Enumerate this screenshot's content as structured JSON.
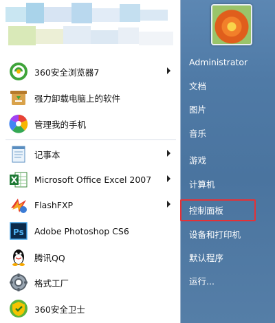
{
  "user": {
    "name": "Administrator"
  },
  "programs": [
    {
      "label": "360安全浏览器7",
      "icon": "360-browser-icon",
      "submenu": true
    },
    {
      "label": "强力卸载电脑上的软件",
      "icon": "uninstall-icon",
      "submenu": false
    },
    {
      "label": "管理我的手机",
      "icon": "phone-manager-icon",
      "submenu": false
    },
    {
      "label": "记事本",
      "icon": "notepad-icon",
      "submenu": true
    },
    {
      "label": "Microsoft Office Excel 2007",
      "icon": "excel-icon",
      "submenu": true
    },
    {
      "label": "FlashFXP",
      "icon": "flashfxp-icon",
      "submenu": true
    },
    {
      "label": "Adobe Photoshop CS6",
      "icon": "photoshop-icon",
      "submenu": false
    },
    {
      "label": "腾讯QQ",
      "icon": "qq-icon",
      "submenu": false
    },
    {
      "label": "格式工厂",
      "icon": "format-factory-icon",
      "submenu": false
    },
    {
      "label": "360安全卫士",
      "icon": "360-safe-icon",
      "submenu": false
    }
  ],
  "right_menu": [
    {
      "label": "Administrator"
    },
    {
      "label": "文档"
    },
    {
      "label": "图片"
    },
    {
      "label": "音乐"
    },
    {
      "label": "游戏"
    },
    {
      "label": "计算机"
    },
    {
      "label": "控制面板",
      "highlighted": true
    },
    {
      "label": "设备和打印机"
    },
    {
      "label": "默认程序"
    },
    {
      "label": "运行..."
    }
  ],
  "colors": {
    "highlight_border": "#e53136",
    "right_panel": "#4f7aa6",
    "text_light": "#ffffff"
  }
}
